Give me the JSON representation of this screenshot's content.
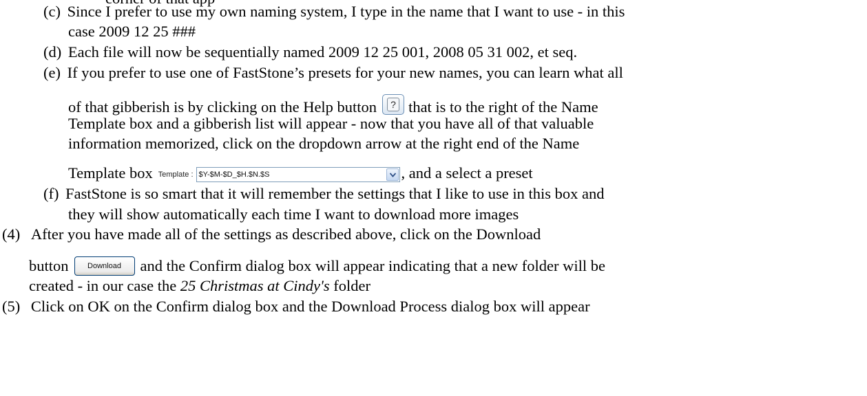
{
  "doc": {
    "line_top": "corner of that app",
    "c_marker": "(c)",
    "c_line1": "Since I prefer to use my own naming system, I type in the name that I want to use - in this",
    "c_line2": "case 2009 12 25 ###",
    "d_marker": "(d)",
    "d_line1": "Each file will now be sequentially named 2009 12 25 001, 2008 05 31 002, et seq.",
    "e_marker": "(e)",
    "e_line1": "If you prefer to use one of FastStone’s presets for your new names, you can learn what all",
    "e_line2_a": "of that gibberish is by clicking on the Help button",
    "e_line2_b": "that is to the right of the Name",
    "e_line3": "Template box and a gibberish list will appear - now that you have all of that valuable",
    "e_line4": "information memorized, click on the dropdown arrow at the right end of the Name",
    "e_line5_a": "Template box",
    "e_line5_b": ", and a select a preset",
    "f_marker": "(f)",
    "f_line1": "FastStone is so smart that it will remember the settings that I like to use in this box and",
    "f_line2": "they will show automatically each time I want to download more images",
    "s4_marker": "(4)",
    "s4_line1": "After you have made all of the settings as described above, click on the Download",
    "s4_line2_a": "button",
    "s4_line2_b": "and the Confirm dialog box will appear indicating that a new folder will be",
    "s4_line3_a": "created - in our case the",
    "s4_line3_italic": "25 Christmas at Cindy's",
    "s4_line3_b": "folder",
    "s5_marker": "(5)",
    "s5_line1": "Click on OK on the Confirm dialog box and the Download Process dialog box will appear"
  },
  "widgets": {
    "help_button_glyph": "?",
    "help_icon": "question-mark-icon",
    "template_label": "Template :",
    "template_value": "$Y-$M-$D_$H.$N.$S",
    "dropdown_icon": "chevron-down-icon",
    "download_label": "Download"
  },
  "colors": {
    "text": "#000000",
    "xp_blue_border": "#7f9db9",
    "button_border": "#003c74"
  }
}
